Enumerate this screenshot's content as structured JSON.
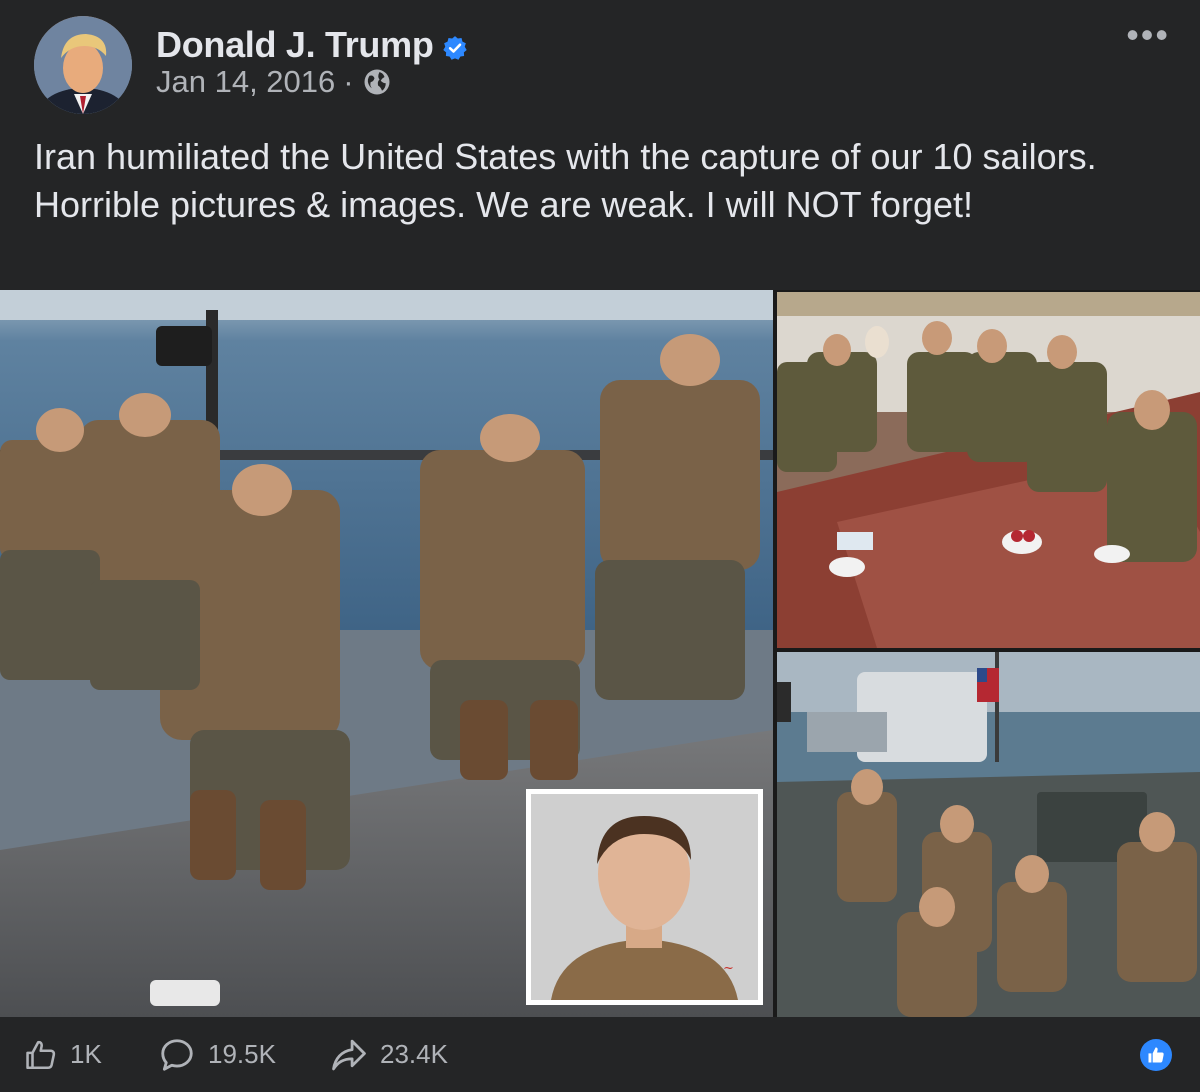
{
  "post": {
    "author": "Donald J. Trump",
    "date": "Jan 14, 2016",
    "separator": "·",
    "more_label": "•••",
    "text": "Iran humiliated the United States with the capture of our 10 sailors. Horrible pictures & images. We are weak. I will NOT forget!"
  },
  "media": {
    "images": [
      {
        "name": "sailors-kneeling-on-boat-photo"
      },
      {
        "name": "sailors-seated-on-carpet-photo"
      },
      {
        "name": "sailors-hands-on-heads-boat-photo"
      },
      {
        "name": "sailor-portrait-inset-photo"
      }
    ]
  },
  "actions": {
    "likes": "1K",
    "comments": "19.5K",
    "shares": "23.4K"
  },
  "colors": {
    "background": "#242526",
    "text_primary": "#e4e6eb",
    "text_secondary": "#b0b3b8",
    "accent_blue": "#2d88ff"
  },
  "icons": {
    "verified": "verified-badge-icon",
    "audience": "globe-icon",
    "like": "thumbs-up-icon",
    "comment": "comment-bubble-icon",
    "share": "share-arrow-icon",
    "reaction": "like-reaction-icon"
  }
}
